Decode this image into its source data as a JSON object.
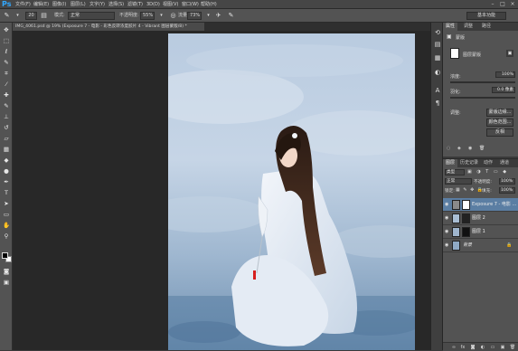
{
  "menu": {
    "logo": "Ps",
    "items": [
      "文件(F)",
      "编辑(E)",
      "图像(I)",
      "图层(L)",
      "文字(Y)",
      "选择(S)",
      "滤镜(T)",
      "3D(D)",
      "视图(V)",
      "窗口(W)",
      "帮助(H)"
    ]
  },
  "options": {
    "brush_size": "20",
    "mode_label": "模式:",
    "mode_value": "正常",
    "opacity_label": "不透明度:",
    "opacity_value": "55%",
    "flow_label": "流量:",
    "flow_value": "73%",
    "workspace": "基本功能"
  },
  "document": {
    "tab_title": "IMG_4061.psd @ 19% (Exposure 7 - 电影 - 彩色反转浓度胶片 4 - Vibrant 图层蒙版/8) *"
  },
  "properties": {
    "tabs": [
      "属性",
      "调整",
      "路径"
    ],
    "title": "蒙版",
    "mask_type": "图层蒙版",
    "density_label": "浓度:",
    "density_value": "100%",
    "feather_label": "羽化:",
    "feather_value": "0.0 像素",
    "refine_label": "调整:",
    "buttons": [
      "蒙版边缘...",
      "颜色范围...",
      "反相"
    ]
  },
  "layers": {
    "tabs": [
      "图层",
      "历史记录",
      "动作",
      "通道"
    ],
    "kind_label": "类型",
    "blend_mode": "正常",
    "opacity_label": "不透明度:",
    "opacity_value": "100%",
    "lock_label": "锁定:",
    "fill_label": "填充:",
    "fill_value": "100%",
    "rows": [
      {
        "name": "Exposure 7 - 电影 ...",
        "selected": true
      },
      {
        "name": "图层 2",
        "selected": false
      },
      {
        "name": "图层 1",
        "selected": false
      },
      {
        "name": "背景",
        "selected": false
      }
    ]
  },
  "icons": {
    "tools": [
      "move-icon",
      "marquee-icon",
      "lasso-icon",
      "quick-select-icon",
      "crop-icon",
      "eyedropper-icon",
      "healing-icon",
      "brush-icon",
      "stamp-icon",
      "history-brush-icon",
      "eraser-icon",
      "gradient-icon",
      "blur-icon",
      "dodge-icon",
      "pen-icon",
      "type-icon",
      "path-select-icon",
      "shape-icon",
      "hand-icon",
      "zoom-icon"
    ]
  }
}
